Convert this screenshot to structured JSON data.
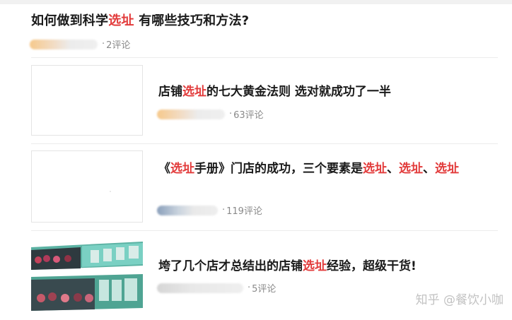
{
  "header_question": {
    "title_prefix": "如何做到科学",
    "title_highlight": "选址",
    "title_suffix": " 有哪些技巧和方法?",
    "comments": "2评论"
  },
  "articles": [
    {
      "title_prefix": "店铺",
      "title_highlight": "选址",
      "title_suffix": "的七大黄金法则 选对就成功了一半",
      "comments": "63评论"
    },
    {
      "title_prefix": "《",
      "title_highlight": "选址",
      "title_mid": "手册》门店的成功，三个要素是",
      "title_h2": "选址",
      "title_sep": "、",
      "title_h3": "选址",
      "title_sep2": "、",
      "title_h4": "选址",
      "comments": "119评论"
    },
    {
      "title_prefix": "垮了几个店才总结出的店铺",
      "title_highlight": "选址",
      "title_suffix": "经验，超级干货!",
      "comments": "5评论"
    }
  ],
  "watermark": "知乎 @餐饮小咖",
  "colors": {
    "highlight": "#e23b3b",
    "meta": "#8a8a8a",
    "separator": "#ececec"
  }
}
